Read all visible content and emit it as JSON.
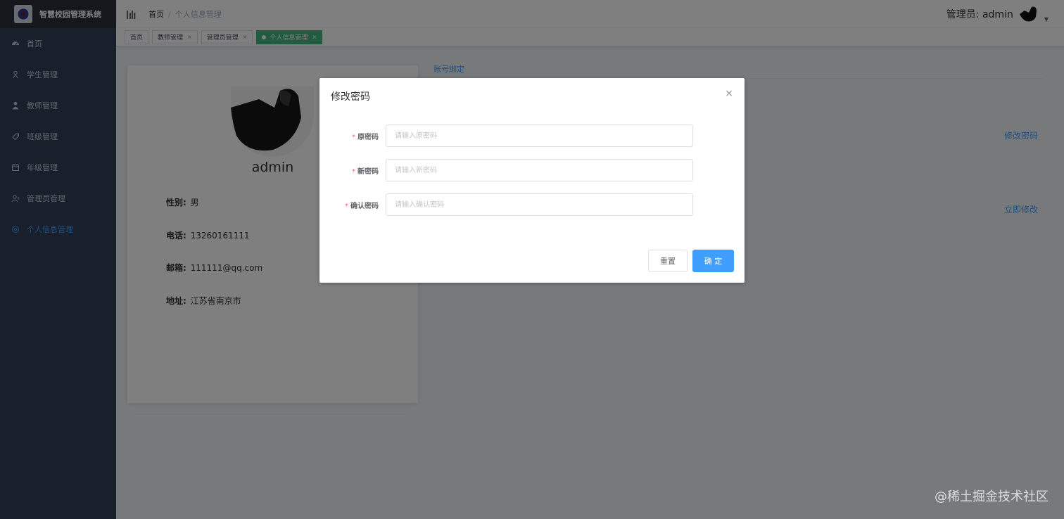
{
  "app": {
    "title": "智慧校园管理系统"
  },
  "sidebar": {
    "items": [
      {
        "label": "首页",
        "icon": "dashboard-icon"
      },
      {
        "label": "学生管理",
        "icon": "student-icon"
      },
      {
        "label": "教师管理",
        "icon": "teacher-icon"
      },
      {
        "label": "班级管理",
        "icon": "class-icon"
      },
      {
        "label": "年级管理",
        "icon": "calendar-icon"
      },
      {
        "label": "管理员管理",
        "icon": "admin-icon"
      },
      {
        "label": "个人信息管理",
        "icon": "settings-icon",
        "active": true
      }
    ]
  },
  "header": {
    "breadcrumb": [
      "首页",
      "个人信息管理"
    ],
    "breadcrumb_sep": "/",
    "user_label": "管理员: admin"
  },
  "tags": [
    {
      "label": "首页",
      "closable": false
    },
    {
      "label": "教师管理",
      "closable": true
    },
    {
      "label": "管理员管理",
      "closable": true
    },
    {
      "label": "个人信息管理",
      "closable": true,
      "active": true
    }
  ],
  "profile": {
    "name": "admin",
    "gender_label": "性别:",
    "gender": "男",
    "phone_label": "电话:",
    "phone": "13260161111",
    "email_label": "邮箱:",
    "email": "111111@qq.com",
    "address_label": "地址:",
    "address": "江苏省南京市"
  },
  "account_panel": {
    "tab": "账号绑定",
    "change_password_link": "修改密码",
    "modify_now_link": "立即修改"
  },
  "dialog": {
    "title": "修改密码",
    "close": "×",
    "fields": [
      {
        "label": "原密码",
        "placeholder": "请输入原密码",
        "required_mark": "*"
      },
      {
        "label": "新密码",
        "placeholder": "请输入新密码",
        "required_mark": "*"
      },
      {
        "label": "确认密码",
        "placeholder": "请输入确认密码",
        "required_mark": "*"
      }
    ],
    "reset_button": "重置",
    "confirm_button": "确 定"
  },
  "watermark": "@稀土掘金技术社区",
  "colors": {
    "sidebar_bg": "#304156",
    "primary": "#409eff",
    "active_tag": "#42b983",
    "required": "#f56c6c"
  }
}
